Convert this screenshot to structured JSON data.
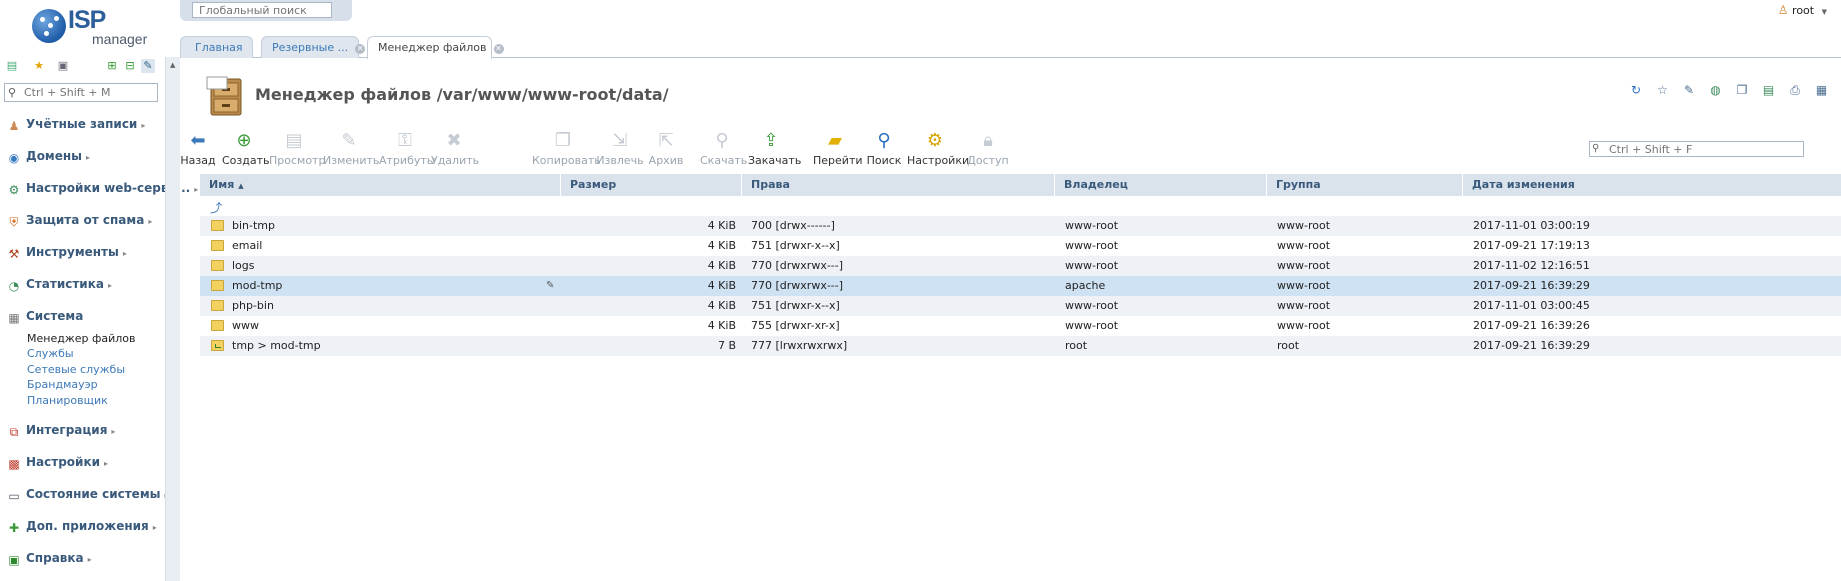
{
  "logo": {
    "word1": "ISP",
    "word2": "manager"
  },
  "global_search": {
    "placeholder": "Глобальный поиск"
  },
  "user": {
    "name": "root"
  },
  "sidebar": {
    "search_placeholder": "Ctrl + Shift + M",
    "sections": [
      {
        "label": "Учётные записи",
        "icon": "users-icon"
      },
      {
        "label": "Домены",
        "icon": "globe-icon"
      },
      {
        "label": "Настройки web-серве...",
        "icon": "web-settings-icon"
      },
      {
        "label": "Защита от спама",
        "icon": "shield-icon"
      },
      {
        "label": "Инструменты",
        "icon": "tools-icon"
      },
      {
        "label": "Статистика",
        "icon": "stats-icon"
      },
      {
        "label": "Система",
        "icon": "system-icon"
      },
      {
        "label": "Интеграция",
        "icon": "integration-icon"
      },
      {
        "label": "Настройки",
        "icon": "settings-icon"
      },
      {
        "label": "Состояние системы",
        "icon": "monitor-icon"
      },
      {
        "label": "Доп. приложения",
        "icon": "plus-icon"
      },
      {
        "label": "Справка",
        "icon": "help-icon"
      }
    ],
    "system_items": [
      "Менеджер файлов",
      "Службы",
      "Сетевые службы",
      "Брандмауэр",
      "Планировщик"
    ]
  },
  "tabs": [
    {
      "label": "Главная"
    },
    {
      "label": "Резервные ..."
    },
    {
      "label": "Менеджер файлов"
    }
  ],
  "page": {
    "title": "Менеджер файлов /var/www/www-root/data/"
  },
  "toolbar": {
    "buttons": [
      {
        "label": "Назад",
        "icon": "back-arrow-icon",
        "enabled": true
      },
      {
        "label": "Создать",
        "icon": "create-icon",
        "enabled": true
      },
      {
        "label": "Просмотр",
        "icon": "view-icon",
        "enabled": false
      },
      {
        "label": "Изменить",
        "icon": "edit-icon",
        "enabled": false
      },
      {
        "label": "Атрибуты",
        "icon": "attributes-icon",
        "enabled": false
      },
      {
        "label": "Удалить",
        "icon": "delete-icon",
        "enabled": false
      },
      {
        "label": "Копировать",
        "icon": "copy-icon",
        "enabled": false
      },
      {
        "label": "Извлечь",
        "icon": "extract-icon",
        "enabled": false
      },
      {
        "label": "Архив",
        "icon": "archive-icon",
        "enabled": false
      },
      {
        "label": "Скачать",
        "icon": "download-icon",
        "enabled": false
      },
      {
        "label": "Закачать",
        "icon": "upload-icon",
        "enabled": true
      },
      {
        "label": "Перейти",
        "icon": "folder-go-icon",
        "enabled": true
      },
      {
        "label": "Поиск",
        "icon": "search-icon",
        "enabled": true
      },
      {
        "label": "Настройки",
        "icon": "gear-icon",
        "enabled": true
      },
      {
        "label": "Доступ",
        "icon": "lock-icon",
        "enabled": false
      }
    ]
  },
  "filter": {
    "placeholder": "Ctrl + Shift + F"
  },
  "table": {
    "columns": [
      "Имя",
      "Размер",
      "Права",
      "Владелец",
      "Группа",
      "Дата изменения"
    ],
    "rows": [
      {
        "name": "bin-tmp",
        "size": "4 KiB",
        "perms": "700 [drwx------]",
        "owner": "www-root",
        "group": "www-root",
        "date": "2017-11-01 03:00:19"
      },
      {
        "name": "email",
        "size": "4 KiB",
        "perms": "751 [drwxr-x--x]",
        "owner": "www-root",
        "group": "www-root",
        "date": "2017-09-21 17:19:13"
      },
      {
        "name": "logs",
        "size": "4 KiB",
        "perms": "770 [drwxrwx---]",
        "owner": "www-root",
        "group": "www-root",
        "date": "2017-11-02 12:16:51"
      },
      {
        "name": "mod-tmp",
        "size": "4 KiB",
        "perms": "770 [drwxrwx---]",
        "owner": "apache",
        "group": "www-root",
        "date": "2017-09-21 16:39:29"
      },
      {
        "name": "php-bin",
        "size": "4 KiB",
        "perms": "751 [drwxr-x--x]",
        "owner": "www-root",
        "group": "www-root",
        "date": "2017-11-01 03:00:45"
      },
      {
        "name": "www",
        "size": "4 KiB",
        "perms": "755 [drwxr-xr-x]",
        "owner": "www-root",
        "group": "www-root",
        "date": "2017-09-21 16:39:26"
      },
      {
        "name": "tmp > mod-tmp",
        "size": "7 B",
        "perms": "777 [lrwxrwxrwx]",
        "owner": "root",
        "group": "root",
        "date": "2017-09-21 16:39:29"
      }
    ]
  }
}
